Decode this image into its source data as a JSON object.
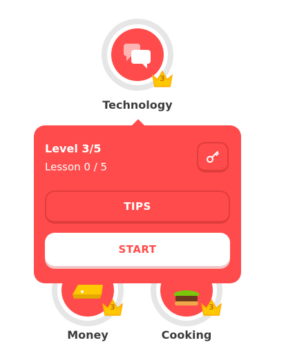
{
  "skills": [
    {
      "label": "Technology",
      "crown_level": "3",
      "icon": "chat-bubbles-icon"
    },
    {
      "label": "Money",
      "crown_level": "3",
      "icon": "gold-bar-icon"
    },
    {
      "label": "Cooking",
      "crown_level": "3",
      "icon": "burger-icon"
    }
  ],
  "popup": {
    "level_title": "Level 3/5",
    "lesson_progress": "Lesson 0 / 5",
    "key_icon": "key-icon",
    "tips_label": "TIPS",
    "start_label": "START"
  },
  "colors": {
    "accent": "#ff4b4b",
    "ring": "#e6e6e6",
    "crown": "#ffc800"
  }
}
